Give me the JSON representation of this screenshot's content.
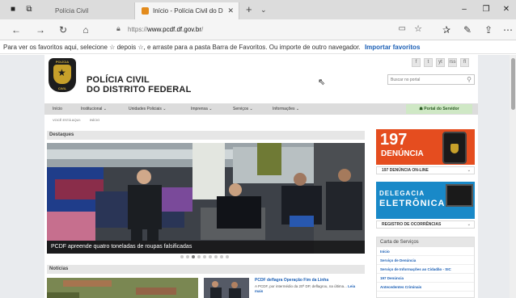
{
  "browser": {
    "tabs": [
      {
        "title": "Polícia Civil",
        "active": false
      },
      {
        "title": "Início - Polícia Civil do D",
        "active": true
      }
    ],
    "address": {
      "scheme": "https://",
      "host": "www.pcdf.df.gov.br",
      "path": "/"
    },
    "favorites_bar": {
      "message": "Para ver os favoritos aqui, selecione ☆ depois ☆, e arraste para a pasta Barra de Favoritos. Ou importe de outro navegador.",
      "link": "Importar favoritos"
    },
    "icons": [
      "tab-actions-icon",
      "tab-preview-icon",
      "back-icon",
      "forward-icon",
      "refresh-icon",
      "home-icon",
      "lock-icon",
      "reading-view-icon",
      "favorite-star-icon",
      "favorites-hub-icon",
      "pen-icon",
      "share-icon",
      "more-icon",
      "minimize-icon",
      "maximize-icon",
      "close-icon"
    ]
  },
  "site": {
    "org_line1": "POLÍCIA CIVIL",
    "org_line2": "DO DISTRITO FEDERAL",
    "logo_text_top": "POLÍCIA",
    "logo_text_bottom": "CIVIL",
    "social": [
      "f",
      "t",
      "yt",
      "rss",
      "fl"
    ],
    "search_placeholder": "Buscar no portal",
    "menu": [
      {
        "label": "Início"
      },
      {
        "label": "Institucional ⌄"
      },
      {
        "label": "Unidades Policiais ⌄"
      },
      {
        "label": "Imprensa ⌄"
      },
      {
        "label": "Serviços ⌄"
      },
      {
        "label": "Informações ⌄"
      }
    ],
    "portal_button": "Portal do Servidor",
    "breadcrumb": [
      "VOCÊ ESTÁ AQUI:",
      "INÍCIO"
    ],
    "destaques": {
      "heading": "Destaques",
      "caption": "PCDF apreende quatro toneladas de roupas falsificadas",
      "slides": 9,
      "active_slide": 2
    },
    "noticias": {
      "heading": "Notícias",
      "item_title": "PCDF deflagra Operação Fim da Linha",
      "item_text": "A PCDF, por intermédio da 20ª DP, deflagrou, na última...",
      "read_more": "Leia mais"
    },
    "banners": {
      "denuncia_number": "197",
      "denuncia_word": "DENÚNCIA",
      "denuncia_label": "197 DENÚNCIA ON-LINE",
      "delegacia_line1": "DELEGACIA",
      "delegacia_line2": "ELETRÔNICA",
      "delegacia_label": "REGISTRO DE OCORRÊNCIAS"
    },
    "carta": {
      "heading": "Carta de Serviços",
      "items": [
        "Início",
        "Serviço de Denúncia",
        "Serviço de Informações ao Cidadão - SIC",
        "197 Denúncia",
        "Antecedentes Criminais"
      ]
    }
  },
  "colors": {
    "chrome": "#dcdcdc",
    "link": "#1b5fb5",
    "denuncia": "#e54d1f",
    "delegacia": "#1989c8",
    "portal": "#cfe8c5"
  }
}
